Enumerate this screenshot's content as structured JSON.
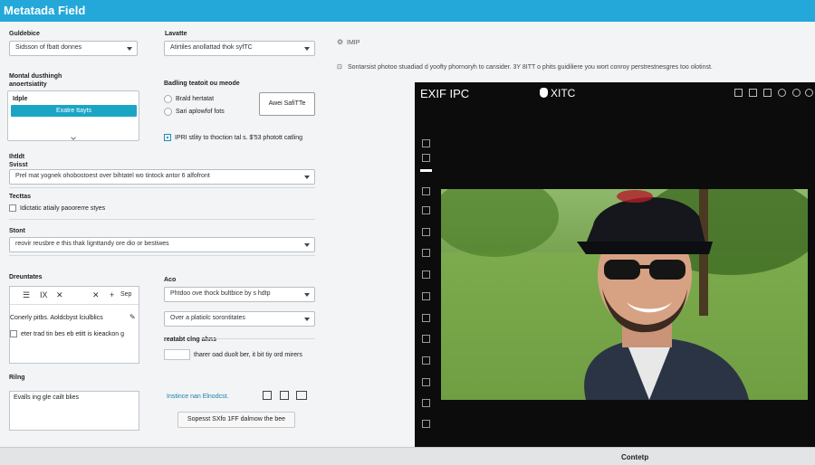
{
  "app": {
    "title": "Metatada Field"
  },
  "left": {
    "guide_label": "Guldebice",
    "guide_select": "Sidsson of fbatt donnes",
    "lavette_label": "Lavatte",
    "lavette_select": "Atirtiles anollattad thok syfTC",
    "montal_label": "Montal dusthingh anoertsiatity",
    "panel_item": "Idple",
    "panel_button": "Exatre ttayts",
    "bading_label": "Badling teatoit ou meode",
    "radio1": "Brald hertatat",
    "radio2": "Sari aplowfof fots",
    "auto_button": "Awei SafiTTe",
    "check_note": "IPRI stlity to thoction tal s.  $'53 photott catling",
    "ithlet_label": "Ihtldt",
    "svisst_label": "Svisst",
    "svisst_select": "Prel mat yognek ohobostoest over bihtatel wo tintock antor 6 alfofront",
    "tecttas_label": "Tecttas",
    "tecttas_check": "Idictatic atiaily paoorerre styes",
    "stont_label": "Stont",
    "stont_select": "reovir reusbre e this thak lignttandy ore dio or bestiwes",
    "dreuntates_label": "Dreuntates",
    "toolbar": {
      "b1": "☰",
      "b2": "IX",
      "b3": "✕",
      "b4": "✕",
      "b5": "+",
      "b6": "Sep"
    },
    "conerly": "Conerly pitbs. Aoldcbyst lciulblics",
    "eter": "eter trad tin bes eb etitt is kieackon g",
    "rilng_label": "Rilng",
    "evalls": "Evalls ing gle cailt blies",
    "aco_label": "Aco",
    "aco_select1": "Phtdoo ove thock bultbice by s hdtp",
    "aco_select2": "Over a platiolc sorontitates",
    "reatab_label": "reatabt clng ahns",
    "thareer": "tharer oad duolt ber, it bit tiy ord mirers",
    "inst_link": "Instince nan Elnodcst.",
    "bottom_button": "Sopesst SXfo 1FF dalmow the bee"
  },
  "mid": {
    "imip": "IMIP",
    "desc": "Sontarsist photoo stuadiad d yoofty phornoryh to cansider. 3Y 8ITT o phits guidiliere you wort conroy perstrestnesgres too olotinst."
  },
  "viewer": {
    "title_left": "EXIF IPC",
    "title_right": " XITC",
    "apple_glyph": "",
    "photo_caption": ""
  },
  "footer": {
    "label": "Contetp"
  }
}
